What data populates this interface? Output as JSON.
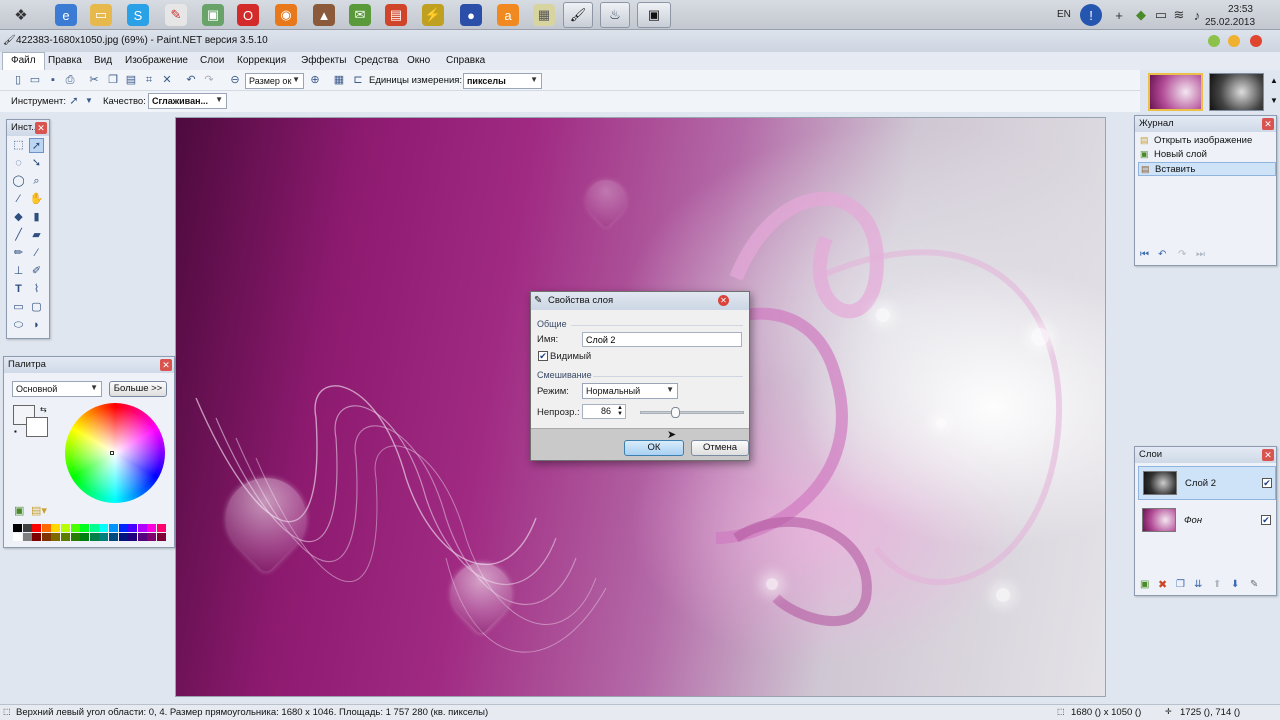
{
  "taskbar": {
    "lang": "EN",
    "time": "23:53",
    "date": "25.02.2013"
  },
  "window": {
    "title": "422383-1680x1050.jpg (69%) - Paint.NET версия 3.5.10"
  },
  "menu": {
    "items": [
      "Файл",
      "Правка",
      "Вид",
      "Изображение",
      "Слои",
      "Коррекция",
      "Эффекты",
      "Средства",
      "Окно",
      "Справка"
    ]
  },
  "toolbar": {
    "zoom_value": "Размер ок",
    "units_label": "Единицы измерения:",
    "units_value": "пикселы",
    "tool_label": "Инструмент:",
    "quality_label": "Качество:",
    "quality_value": "Сглаживан..."
  },
  "tools_panel": {
    "title": "Инст..."
  },
  "palette_panel": {
    "title": "Палитра",
    "mode": "Основной",
    "more_button": "Больше >>",
    "swatches": [
      "#000000",
      "#404040",
      "#ff0000",
      "#ff6a00",
      "#ffd800",
      "#b6ff00",
      "#4cff00",
      "#00ff21",
      "#00ff90",
      "#00ffff",
      "#0094ff",
      "#0026ff",
      "#4800ff",
      "#b200ff",
      "#ff00dc",
      "#ff006e",
      "#ffffff",
      "#808080",
      "#7f0000",
      "#7f3300",
      "#7f6a00",
      "#5b7f00",
      "#267f00",
      "#007f0e",
      "#007f46",
      "#007f7f",
      "#004a7f",
      "#00137f",
      "#21007f",
      "#57007f",
      "#7f006e",
      "#7f0037"
    ]
  },
  "journal_panel": {
    "title": "Журнал",
    "items": [
      "Открыть изображение",
      "Новый слой",
      "Вставить"
    ]
  },
  "layers_panel": {
    "title": "Слои",
    "layers": [
      {
        "name": "Слой 2",
        "visible": true
      },
      {
        "name": "Фон",
        "visible": true
      }
    ]
  },
  "dialog": {
    "title": "Свойства слоя",
    "group_general": "Общие",
    "name_label": "Имя:",
    "name_value": "Слой 2",
    "visible_label": "Видимый",
    "group_blend": "Смешивание",
    "mode_label": "Режим:",
    "mode_value": "Нормальный",
    "opacity_label": "Непрозр.:",
    "opacity_value": "86",
    "ok": "ОК",
    "cancel": "Отмена"
  },
  "statusbar": {
    "info": "Верхний левый угол области: 0, 4. Размер прямоугольника: 1680 x 1046. Площадь: 1 757 280 (кв. пикселы)",
    "image_size": "1680 () x 1050 ()",
    "cursor": "1725 (), 714 ()"
  },
  "colors": {
    "accent": "#3c7fb1",
    "selection": "#cfe3f8"
  }
}
